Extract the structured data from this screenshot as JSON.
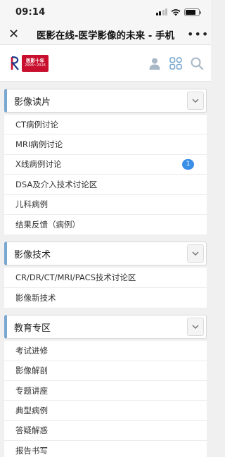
{
  "status_bar": {
    "time": "09:14"
  },
  "nav": {
    "title": "医影在线-医学影像的未来 - 手机",
    "close_glyph": "✕",
    "more_glyph": "•••"
  },
  "header": {
    "logo_badge_line1": "医影十年",
    "logo_badge_line2": "2006~2016",
    "icons": [
      "user-icon",
      "grid-icon",
      "search-icon"
    ]
  },
  "accent_color": "#7aa7cf",
  "badge_color": "#3b8ee6",
  "sections": [
    {
      "title": "影像读片",
      "items": [
        {
          "label": "CT病例讨论"
        },
        {
          "label": "MRI病例讨论"
        },
        {
          "label": "X线病例讨论",
          "badge": "1"
        },
        {
          "label": "DSA及介入技术讨论区"
        },
        {
          "label": "儿科病例"
        },
        {
          "label": "结果反馈（病例）"
        }
      ]
    },
    {
      "title": "影像技术",
      "items": [
        {
          "label": "CR/DR/CT/MRI/PACS技术讨论区"
        },
        {
          "label": "影像新技术"
        }
      ]
    },
    {
      "title": "教育专区",
      "items": [
        {
          "label": "考试进修"
        },
        {
          "label": "影像解剖"
        },
        {
          "label": "专题讲座"
        },
        {
          "label": "典型病例"
        },
        {
          "label": "答疑解惑"
        },
        {
          "label": "报告书写"
        }
      ]
    }
  ]
}
